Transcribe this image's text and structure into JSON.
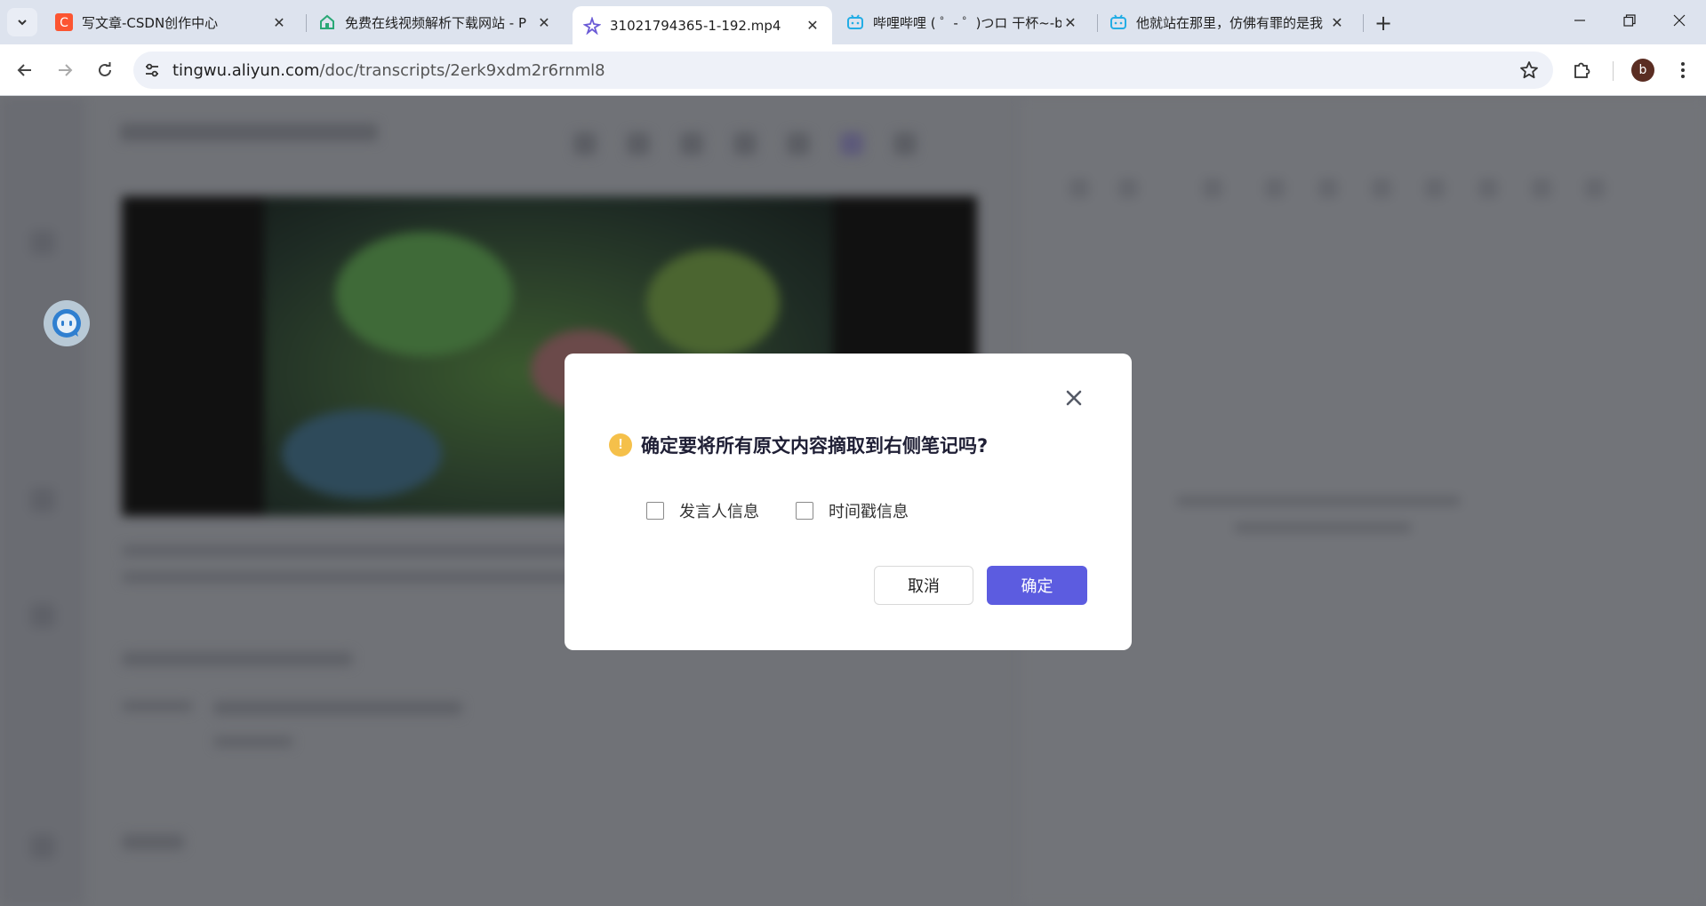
{
  "browser": {
    "tabs": [
      {
        "title": "写文章-CSDN创作中心",
        "active": false
      },
      {
        "title": "免费在线视频解析下载网站 - P",
        "active": false
      },
      {
        "title": "31021794365-1-192.mp4",
        "active": true
      },
      {
        "title": "哔哩哔哩 ( ゜- ゜)つロ 干杯~-bi",
        "active": false
      },
      {
        "title": "他就站在那里，仿佛有罪的是我",
        "active": false
      }
    ],
    "url_host": "tingwu.aliyun.com",
    "url_path": "/doc/transcripts/2erk9xdm2r6rnml8",
    "profile_initial": "b",
    "colors": {
      "accent": "#5c5ce0",
      "warning": "#f5c04a"
    }
  },
  "dialog": {
    "title": "确定要将所有原文内容摘取到右侧笔记吗?",
    "options": [
      {
        "label": "发言人信息",
        "checked": false
      },
      {
        "label": "时间戳信息",
        "checked": false
      }
    ],
    "cancel_label": "取消",
    "confirm_label": "确定"
  }
}
